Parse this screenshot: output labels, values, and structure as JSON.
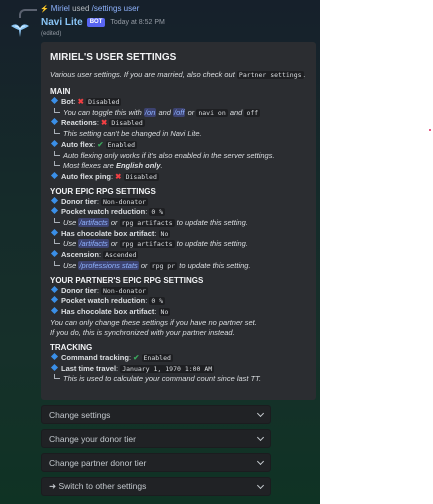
{
  "reply": {
    "user": "Miriel",
    "verb": "used",
    "command": "/settings user"
  },
  "message": {
    "bot_name": "Navi Lite",
    "badge": "BOT",
    "timestamp": "Today at 8:52 PM",
    "edited": "(edited)"
  },
  "embed": {
    "title": "MIRIEL'S USER SETTINGS",
    "desc_pre": "Various user settings. If you are married, also check out",
    "desc_code": "Partner settings",
    "desc_post": ".",
    "main": {
      "heading": "MAIN",
      "bot_label": "Bot",
      "bot_value": "Disabled",
      "bot_sub_pre": "You can toggle this with",
      "bot_sub_on": "/on",
      "bot_sub_and": "and",
      "bot_sub_off": "/off",
      "bot_sub_or": "or",
      "bot_sub_c1": "navi on",
      "bot_sub_and2": "and",
      "bot_sub_c2": "off",
      "reactions_label": "Reactions",
      "reactions_value": "Disabled",
      "reactions_sub": "This setting can't be changed in Navi Lite.",
      "autoflex_label": "Auto flex",
      "autoflex_value": "Enabled",
      "autoflex_sub1": "Auto flexing only works if it's also enabled in the server settings.",
      "autoflex_sub2_pre": "Most flexes are",
      "autoflex_sub2_b": "English only",
      "autoflex_sub2_post": ".",
      "ping_label": "Auto flex ping",
      "ping_value": "Disabled"
    },
    "epic": {
      "heading": "YOUR EPIC RPG SETTINGS",
      "donor_label": "Donor tier",
      "donor_value": "Non-donator",
      "watch_label": "Pocket watch reduction",
      "watch_value": "0 %",
      "watch_sub_pre": "Use",
      "watch_sub_link": "/artifacts",
      "watch_sub_or": "or",
      "watch_sub_code": "rpg artifacts",
      "watch_sub_post": "to update this setting.",
      "choc_label": "Has chocolate box artifact",
      "choc_value": "No",
      "choc_sub_pre": "Use",
      "choc_sub_link": "/artifacts",
      "choc_sub_or": "or",
      "choc_sub_code": "rpg artifacts",
      "choc_sub_post": "to update this setting.",
      "asc_label": "Ascension",
      "asc_value": "Ascended",
      "asc_sub_pre": "Use",
      "asc_sub_link": "/professions stats",
      "asc_sub_or": "or",
      "asc_sub_code": "rpg pr",
      "asc_sub_post": "to update this setting."
    },
    "partner": {
      "heading": "YOUR PARTNER'S EPIC RPG SETTINGS",
      "donor_label": "Donor tier",
      "donor_value": "Non-donator",
      "watch_label": "Pocket watch reduction",
      "watch_value": "0 %",
      "choc_label": "Has chocolate box artifact",
      "choc_value": "No",
      "note1": "You can only change these settings if you have no partner set.",
      "note2": "If you do, this is synchronized with your partner instead."
    },
    "tracking": {
      "heading": "TRACKING",
      "cmd_label": "Command tracking",
      "cmd_value": "Enabled",
      "last_label": "Last time travel",
      "last_value": "January 1, 1970 1:00 AM",
      "last_sub": "This is used to calculate your command count since last TT."
    }
  },
  "dropdowns": [
    "Change settings",
    "Change your donor tier",
    "Change partner donor tier",
    "➜ Switch to other settings"
  ],
  "colors": {
    "accent": "#5865f2",
    "link": "#8fb3ff",
    "disabled": "#f23f43",
    "enabled": "#3ba55c",
    "bullet": "#3a8fe8"
  }
}
